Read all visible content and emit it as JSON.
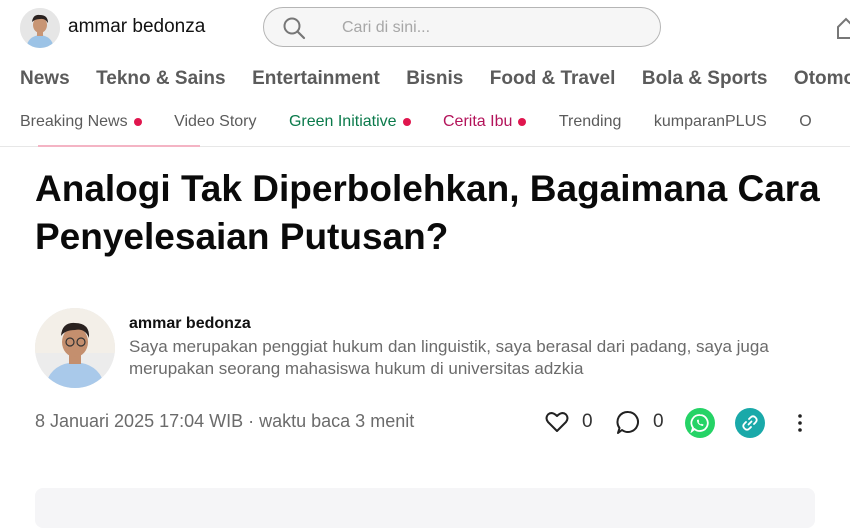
{
  "header": {
    "username": "ammar bedonza",
    "search": {
      "placeholder": "Cari di sini..."
    }
  },
  "main_nav": [
    "News",
    "Tekno & Sains",
    "Entertainment",
    "Bisnis",
    "Food & Travel",
    "Bola & Sports",
    "Otomot"
  ],
  "sub_nav": [
    {
      "label": "Breaking News",
      "color": "#5b5b5b",
      "dot": true
    },
    {
      "label": "Video Story",
      "color": "#5b5b5b",
      "dot": false
    },
    {
      "label": "Green Initiative",
      "color": "#0b7a4b",
      "dot": true
    },
    {
      "label": "Cerita Ibu",
      "color": "#b3135a",
      "dot": true
    },
    {
      "label": "Trending",
      "color": "#5b5b5b",
      "dot": false
    },
    {
      "label": "kumparanPLUS",
      "color": "#5b5b5b",
      "dot": false
    },
    {
      "label": "O",
      "color": "#5b5b5b",
      "dot": false
    }
  ],
  "article": {
    "title": "Analogi Tak Diperbolehkan, Bagaimana Cara Penyelesaian Putusan?",
    "author": {
      "name": "ammar bedonza",
      "bio": "Saya merupakan penggiat hukum dan linguistik, saya berasal dari padang, saya juga merupakan seorang mahasiswa hukum di universitas adzkia"
    },
    "meta": "8 Januari 2025 17:04 WIB · waktu baca 3 menit",
    "likes": "0",
    "comments": "0"
  },
  "icons": {
    "search": "search-icon",
    "home": "home-icon",
    "heart": "heart-icon",
    "comment": "comment-icon",
    "whatsapp": "whatsapp-icon",
    "link": "link-icon",
    "more": "more-vertical-icon"
  },
  "colors": {
    "accent_dot": "#e0164e",
    "whatsapp": "#25d366",
    "share_link": "#1aa9a9"
  }
}
